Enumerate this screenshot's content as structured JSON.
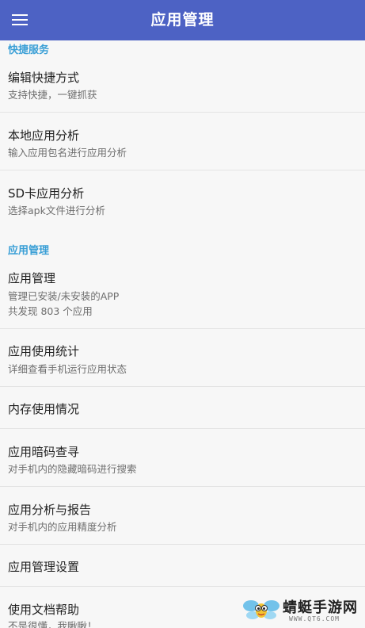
{
  "appbar": {
    "title": "应用管理",
    "menu_icon": "hamburger-menu-icon"
  },
  "sections": [
    {
      "header": "快捷服务",
      "items": [
        {
          "title": "编辑快捷方式",
          "subtitle": "支持快捷，一键抓获"
        },
        {
          "title": "本地应用分析",
          "subtitle": "输入应用包名进行应用分析"
        },
        {
          "title": "SD卡应用分析",
          "subtitle": "选择apk文件进行分析"
        }
      ]
    },
    {
      "header": "应用管理",
      "items": [
        {
          "title": "应用管理",
          "subtitle": "管理已安装/未安装的APP",
          "subtitle2": "共发现 803 个应用"
        },
        {
          "title": "应用使用统计",
          "subtitle": "详细查看手机运行应用状态"
        },
        {
          "title": "内存使用情况"
        },
        {
          "title": "应用暗码查寻",
          "subtitle": "对手机内的隐藏暗码进行搜索"
        },
        {
          "title": "应用分析与报告",
          "subtitle": "对手机内的应用精度分析"
        },
        {
          "title": "应用管理设置"
        },
        {
          "title": "使用文档帮助",
          "subtitle": "不是很懂，我瞅瞅！"
        }
      ]
    }
  ],
  "watermark": {
    "logo_icon": "dragonfly-logo-icon",
    "text": "蜻蜓手游网",
    "url": "WWW.QT6.COM"
  },
  "colors": {
    "appbar": "#4d62c4",
    "section_header": "#3a9fd6",
    "background": "#f7f7f7"
  }
}
